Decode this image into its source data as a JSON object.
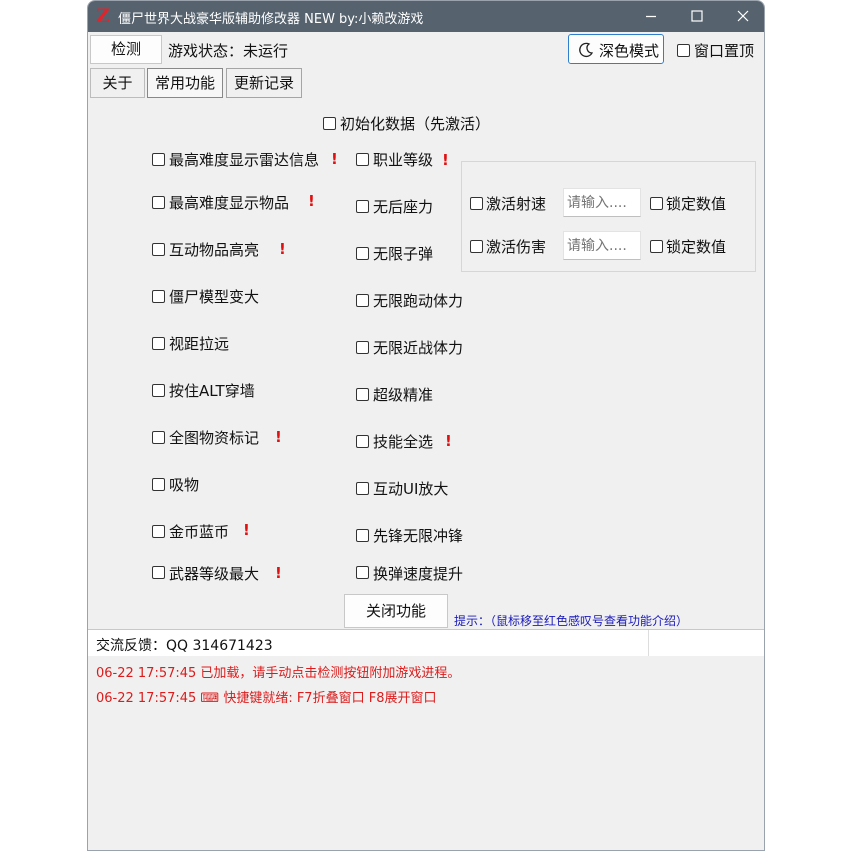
{
  "window": {
    "title": "僵尸世界大战豪华版辅助修改器 NEW  by:小赖改游戏",
    "app_icon_glyph": "Z",
    "title_color": "#56636f"
  },
  "toolbar": {
    "detect_label": "检测",
    "game_status": "游戏状态：未运行",
    "dark_mode_label": "深色模式",
    "pin_window_label": "窗口置顶"
  },
  "tabs": [
    {
      "label": "关于"
    },
    {
      "label": "常用功能"
    },
    {
      "label": "更新记录"
    }
  ],
  "init_option": "初始化数据（先激活）",
  "left_options": [
    {
      "label": "最高难度显示雷达信息",
      "warn": "!"
    },
    {
      "label": "最高难度显示物品",
      "warn": "!"
    },
    {
      "label": "互动物品高亮",
      "warn": "!"
    },
    {
      "label": "僵尸模型变大",
      "warn": ""
    },
    {
      "label": "视距拉远",
      "warn": ""
    },
    {
      "label": "按住ALT穿墙",
      "warn": ""
    },
    {
      "label": "全图物资标记",
      "warn": "!"
    },
    {
      "label": "吸物",
      "warn": ""
    },
    {
      "label": "金币蓝币",
      "warn": "!"
    },
    {
      "label": "武器等级最大",
      "warn": "!"
    }
  ],
  "mid_options": [
    {
      "label": "职业等级",
      "warn": "!"
    },
    {
      "label": "无后座力",
      "warn": ""
    },
    {
      "label": "无限子弹",
      "warn": ""
    },
    {
      "label": "无限跑动体力",
      "warn": ""
    },
    {
      "label": "无限近战体力",
      "warn": ""
    },
    {
      "label": "超级精准",
      "warn": ""
    },
    {
      "label": "技能全选",
      "warn": "!"
    },
    {
      "label": "互动UI放大",
      "warn": ""
    },
    {
      "label": "先锋无限冲锋",
      "warn": ""
    },
    {
      "label": "换弹速度提升",
      "warn": ""
    }
  ],
  "group": {
    "rows": [
      {
        "label": "激活射速",
        "placeholder": "请输入....",
        "lock_label": "锁定数值"
      },
      {
        "label": "激活伤害",
        "placeholder": "请输入....",
        "lock_label": "锁定数值"
      }
    ]
  },
  "close_button": "关闭功能",
  "hint": "提示：（鼠标移至红色感叹号查看功能介绍）",
  "feedback": "交流反馈：QQ 314671423",
  "log": [
    "06-22 17:57:45 已加载，请手动点击检测按钮附加游戏进程。",
    "06-22 17:57:45 ⌨ 快捷键就绪: F7折叠窗口  F8展开窗口"
  ],
  "colors": {
    "warning": "#e01010",
    "hint": "#1a1ab8",
    "log_text": "#dc1c1c"
  }
}
